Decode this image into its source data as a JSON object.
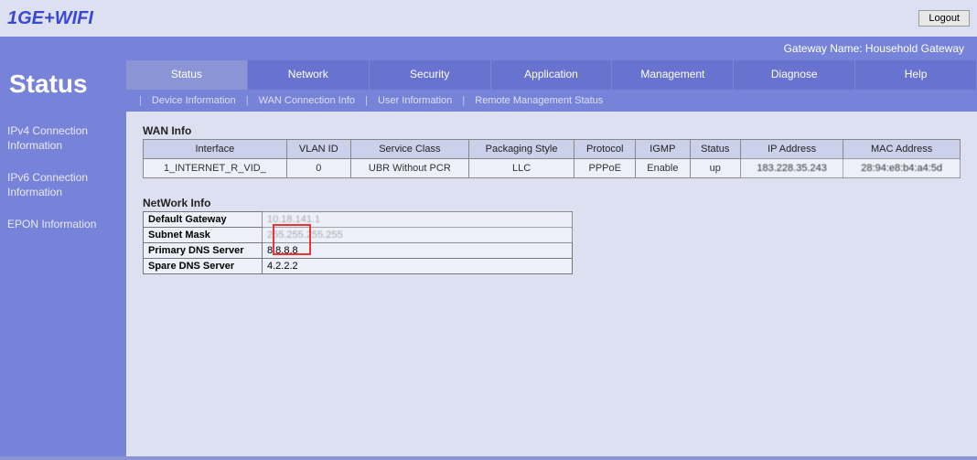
{
  "header": {
    "logo": "1GE+WIFI",
    "logout": "Logout",
    "gateway_name_label": "Gateway Name: Household Gateway"
  },
  "sidebar": {
    "title": "Status",
    "items": [
      {
        "label": "IPv4 Connection Information"
      },
      {
        "label": "IPv6 Connection Information"
      },
      {
        "label": "EPON Information"
      }
    ]
  },
  "tabs": [
    "Status",
    "Network",
    "Security",
    "Application",
    "Management",
    "Diagnose",
    "Help"
  ],
  "subtabs": [
    "Device Information",
    "WAN Connection Info",
    "User Information",
    "Remote Management Status"
  ],
  "wan": {
    "title": "WAN Info",
    "headers": [
      "Interface",
      "VLAN ID",
      "Service Class",
      "Packaging Style",
      "Protocol",
      "IGMP",
      "Status",
      "IP Address",
      "MAC Address"
    ],
    "row": {
      "interface": "1_INTERNET_R_VID_",
      "vlan": "0",
      "service": "UBR Without PCR",
      "packaging": "LLC",
      "protocol": "PPPoE",
      "igmp": "Enable",
      "status": "up",
      "ip": "183.228.35.243",
      "mac": "28:94:e8:b4:a4:5d"
    }
  },
  "net": {
    "title": "NetWork Info",
    "default_gateway_label": "Default Gateway",
    "default_gateway": "10.18.141.1",
    "subnet_mask_label": "Subnet Mask",
    "subnet_mask": "255.255.255.255",
    "primary_dns_label": "Primary DNS Server",
    "primary_dns": "8.8.8.8",
    "spare_dns_label": "Spare DNS Server",
    "spare_dns": "4.2.2.2"
  }
}
